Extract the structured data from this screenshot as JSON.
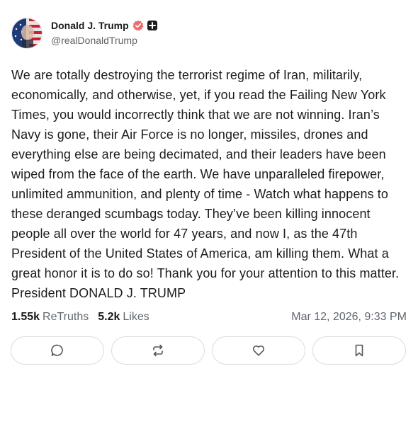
{
  "author": {
    "display_name": "Donald J. Trump",
    "handle": "@realDonaldTrump",
    "avatar_icon": "flag-portrait-avatar",
    "verified_icon": "verified-badge-icon",
    "verified_color": "#ef6b6b",
    "extra_badge_icon": "plus-badge-icon"
  },
  "post": {
    "text": "We are totally destroying the terrorist regime of Iran, militarily, economically, and otherwise, yet, if you read the Failing New York Times, you would incorrectly think that we are not winning. Iran’s Navy is gone, their Air Force is no longer, missiles, drones and everything else are being decimated, and their leaders have been wiped from the face of the earth. We have unparalleled firepower, unlimited ammunition, and plenty of time - Watch what happens to these deranged scumbags today. They’ve been killing innocent people all over the world for 47 years, and now I, as the 47th President of the United States of America, am killing them. What a great honor it is to do so! Thank you for your attention to this matter. President DONALD J. TRUMP"
  },
  "stats": {
    "retruths_count": "1.55k",
    "retruths_label": "ReTruths",
    "likes_count": "5.2k",
    "likes_label": "Likes",
    "timestamp": "Mar 12, 2026, 9:33 PM"
  },
  "actions": [
    {
      "name": "reply-button",
      "icon": "comment-icon"
    },
    {
      "name": "retruth-button",
      "icon": "repost-icon"
    },
    {
      "name": "like-button",
      "icon": "heart-icon"
    },
    {
      "name": "bookmark-button",
      "icon": "bookmark-icon"
    }
  ]
}
